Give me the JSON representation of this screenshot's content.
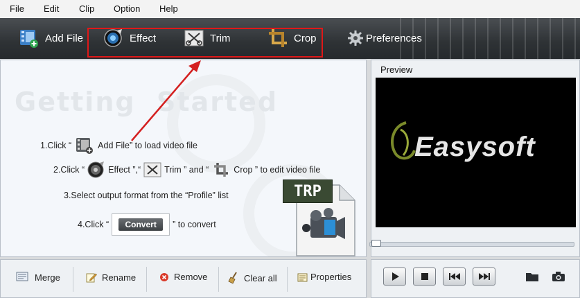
{
  "menu": {
    "items": [
      "File",
      "Edit",
      "Clip",
      "Option",
      "Help"
    ]
  },
  "toolbar": {
    "add_file": "Add File",
    "effect": "Effect",
    "trim": "Trim",
    "crop": "Crop",
    "preferences": "Preferences"
  },
  "getting_started": {
    "title": "Getting  Started",
    "step1_prefix": "1.Click “",
    "step1_name": "Add File",
    "step1_suffix": "” to load video file",
    "step2_prefix": "2.Click “",
    "step2_effect": "Effect ”,“",
    "step2_trim": "Trim ” and “",
    "step2_crop": "Crop ” to edit video file",
    "step3": "3.Select output format from the “Profile” list",
    "step4_prefix": "4.Click “",
    "step4_button": "Convert",
    "step4_suffix": "” to convert",
    "format_badge": "TRP"
  },
  "list_actions": {
    "merge": "Merge",
    "rename": "Rename",
    "remove": "Remove",
    "clear_all": "Clear all",
    "properties": "Properties"
  },
  "preview": {
    "label": "Preview",
    "logo_text": "Easysoft",
    "progress_fraction": 0.0
  },
  "colors": {
    "highlight": "#e01818",
    "arrow": "#d42020",
    "toolbar_bg": "#2e3235"
  }
}
